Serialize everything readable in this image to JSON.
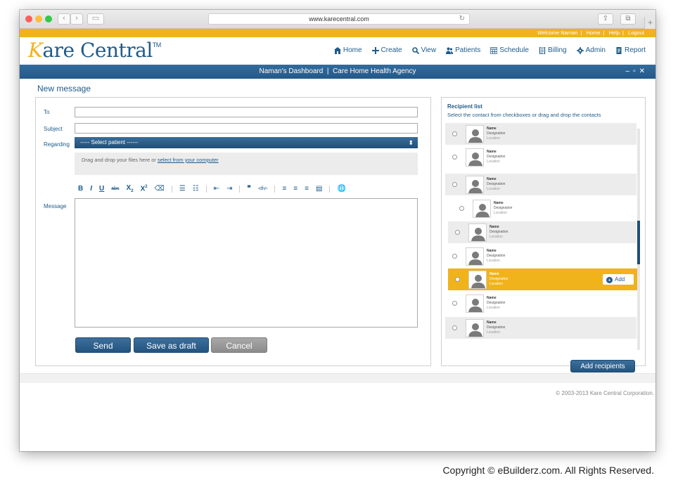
{
  "browser": {
    "url": "www.karecentral.com"
  },
  "toplinks": {
    "welcome": "Welcome Naman",
    "home": "Home",
    "help": "Help",
    "logout": "Logout"
  },
  "brand": {
    "logo_k": "K",
    "logo_rest": "are Central",
    "tm": "TM"
  },
  "nav": [
    {
      "label": "Home",
      "icon": "home-icon"
    },
    {
      "label": "Create",
      "icon": "plus-icon"
    },
    {
      "label": "View",
      "icon": "search-icon"
    },
    {
      "label": "Patients",
      "icon": "users-icon"
    },
    {
      "label": "Schedule",
      "icon": "calendar-icon"
    },
    {
      "label": "Billing",
      "icon": "billing-icon"
    },
    {
      "label": "Admin",
      "icon": "gear-icon"
    },
    {
      "label": "Report",
      "icon": "report-icon"
    }
  ],
  "dashbar": {
    "title": "Naman's Dashboard",
    "agency": "Care Home Health Agency"
  },
  "page": {
    "title": "New message"
  },
  "form": {
    "to_label": "To",
    "subject_label": "Subject",
    "regarding_label": "Regarding",
    "select_placeholder": "----- Select patient ------",
    "drop_text": "Drag and drop your files here or",
    "drop_link": "select from your computer",
    "message_label": "Message",
    "send_label": "Send",
    "draft_label": "Save as draft",
    "cancel_label": "Cancel"
  },
  "recipients": {
    "title": "Recipient list",
    "subtitle": "Select the contact from checkboxes or drag and drop the contacts",
    "items": [
      {
        "name": "Name",
        "designation": "Designation",
        "location": "Location"
      },
      {
        "name": "Name",
        "designation": "Designation",
        "location": "Location"
      },
      {
        "name": "Name",
        "designation": "Designation",
        "location": "Location"
      },
      {
        "name": "Name",
        "designation": "Designation",
        "location": "Location"
      },
      {
        "name": "Name",
        "designation": "Designation",
        "location": "Location"
      },
      {
        "name": "Name",
        "designation": "Designation",
        "location": "Location"
      },
      {
        "name": "Name",
        "designation": "Designation",
        "location": "Location"
      },
      {
        "name": "Name",
        "designation": "Designation",
        "location": "Location"
      },
      {
        "name": "Name",
        "designation": "Designation",
        "location": "Location"
      }
    ],
    "add_label": "Add",
    "add_recipients_label": "Add recipients"
  },
  "footer": {
    "copyright": "© 2003-2013 Kare Central Corporation.",
    "watermark": "Copyright © eBuilderz.com. All Rights Reserved."
  },
  "colors": {
    "brand_blue": "#1f5b8a",
    "accent_yellow": "#f0b31b"
  }
}
